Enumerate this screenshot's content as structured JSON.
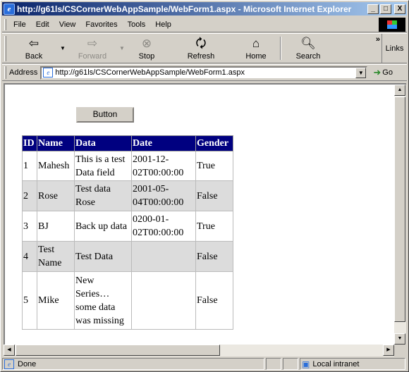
{
  "window": {
    "title": "http://g61ls/CSCornerWebAppSample/WebForm1.aspx - Microsoft Internet Explorer",
    "controls": {
      "minimize": "_",
      "maximize": "□",
      "close": "X"
    }
  },
  "menu": {
    "items": [
      {
        "label": "File"
      },
      {
        "label": "Edit"
      },
      {
        "label": "View"
      },
      {
        "label": "Favorites"
      },
      {
        "label": "Tools"
      },
      {
        "label": "Help"
      }
    ]
  },
  "toolbar": {
    "back": {
      "label": "Back",
      "icon": "back-arrow-icon"
    },
    "forward": {
      "label": "Forward",
      "icon": "forward-arrow-icon"
    },
    "stop": {
      "label": "Stop",
      "icon": "stop-icon"
    },
    "refresh": {
      "label": "Refresh",
      "icon": "refresh-icon"
    },
    "home": {
      "label": "Home",
      "icon": "home-icon"
    },
    "search": {
      "label": "Search",
      "icon": "search-icon"
    },
    "chevron": "»",
    "links": "Links"
  },
  "address": {
    "label": "Address",
    "url": "http://g61ls/CSCornerWebAppSample/WebForm1.aspx",
    "go_label": "Go"
  },
  "page": {
    "button_label": "Button",
    "grid": {
      "header_bg": "#000080",
      "alt_row_bg": "#dcdcdc",
      "columns": [
        "ID",
        "Name",
        "Data",
        "Date",
        "Gender"
      ],
      "rows": [
        {
          "id": "1",
          "name": "Mahesh",
          "data": "This is a test Data field",
          "date": "2001-12-02T00:00:00",
          "gender": "True"
        },
        {
          "id": "2",
          "name": "Rose",
          "data": "Test data Rose",
          "date": "2001-05-04T00:00:00",
          "gender": "False"
        },
        {
          "id": "3",
          "name": "BJ",
          "data": "Back up data",
          "date": "0200-01-02T00:00:00",
          "gender": "True"
        },
        {
          "id": "4",
          "name": "Test Name",
          "data": "Test Data",
          "date": "",
          "gender": "False"
        },
        {
          "id": "5",
          "name": "Mike",
          "data": "New Series… some data was missing",
          "date": "",
          "gender": "False"
        }
      ]
    }
  },
  "status": {
    "text": "Done",
    "zone": "Local intranet"
  }
}
